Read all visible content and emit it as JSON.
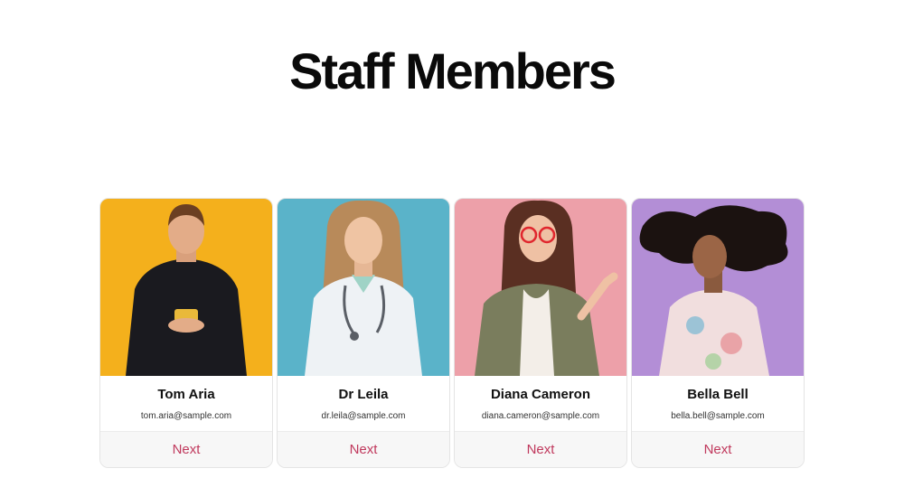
{
  "page": {
    "title": "Staff Members"
  },
  "cards": [
    {
      "name": "Tom Aria",
      "email": "tom.aria@sample.com",
      "button": "Next",
      "bg": "#f4b01c"
    },
    {
      "name": "Dr Leila",
      "email": "dr.leila@sample.com",
      "button": "Next",
      "bg": "#5ab3c9"
    },
    {
      "name": "Diana Cameron",
      "email": "diana.cameron@sample.com",
      "button": "Next",
      "bg": "#eda0a9"
    },
    {
      "name": "Bella Bell",
      "email": "bella.bell@sample.com",
      "button": "Next",
      "bg": "#b38ed6"
    }
  ],
  "accent_color": "#c0395d"
}
